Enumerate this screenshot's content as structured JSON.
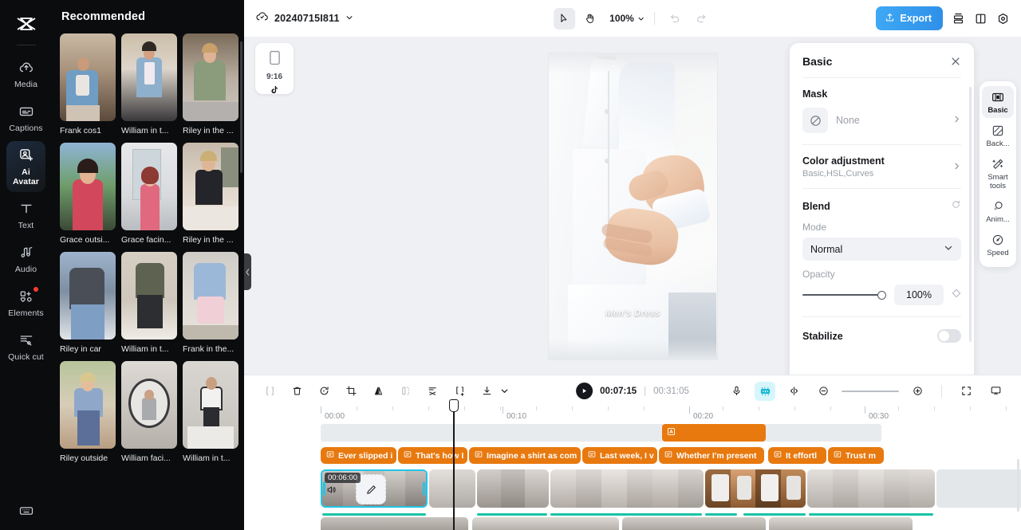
{
  "app": {
    "name": "CapCut"
  },
  "rail": {
    "items": [
      {
        "label": "Media",
        "icon": "cloud-upload-icon",
        "active": false,
        "badge": false
      },
      {
        "label": "Captions",
        "icon": "captions-icon",
        "active": false,
        "badge": false
      },
      {
        "label": "Ai Avatar",
        "icon": "ai-avatar-icon",
        "active": true,
        "badge": false
      },
      {
        "label": "Text",
        "icon": "text-icon",
        "active": false,
        "badge": false
      },
      {
        "label": "Audio",
        "icon": "audio-icon",
        "active": false,
        "badge": false
      },
      {
        "label": "Elements",
        "icon": "elements-icon",
        "active": false,
        "badge": true
      },
      {
        "label": "Quick cut",
        "icon": "quick-cut-icon",
        "active": false,
        "badge": false
      }
    ],
    "bottom_icon": "keyboard-shortcuts-icon"
  },
  "media": {
    "title": "Recommended",
    "items": [
      {
        "name": "Frank cos1"
      },
      {
        "name": "William in t..."
      },
      {
        "name": "Riley in the ..."
      },
      {
        "name": "Grace outsi..."
      },
      {
        "name": "Grace facin..."
      },
      {
        "name": "Riley in the ..."
      },
      {
        "name": "Riley in car"
      },
      {
        "name": "William in t..."
      },
      {
        "name": "Frank in the..."
      },
      {
        "name": "Riley outside"
      },
      {
        "name": "William faci..."
      },
      {
        "name": "William in t..."
      }
    ]
  },
  "topbar": {
    "project_name": "20240715I811",
    "project_icon": "cloud-sync-icon",
    "chevron_icon": "chevron-down-icon",
    "select_tool_icon": "cursor-arrow-icon",
    "hand_tool_icon": "hand-icon",
    "zoom_level": "100%",
    "undo_icon": "undo-icon",
    "redo_icon": "redo-icon",
    "export_label": "Export",
    "export_icon": "upload-icon",
    "export_color": "#3fa0ef",
    "right_icons": [
      {
        "name": "layout-stack-icon"
      },
      {
        "name": "split-view-icon"
      },
      {
        "name": "settings-gear-icon"
      }
    ]
  },
  "stage": {
    "ratio_card": {
      "ratio": "9:16",
      "platform_icon": "tiktok-icon",
      "frame_icon": "portrait-frame-icon"
    },
    "preview": {
      "watermark": "Men's Dress"
    }
  },
  "props": {
    "title": "Basic",
    "close_icon": "close-icon",
    "mask": {
      "label": "Mask",
      "value": "None",
      "icon": "mask-none-icon",
      "chevron": "chevron-right-icon"
    },
    "color_adjustment": {
      "label": "Color adjustment",
      "sub": "Basic,HSL,Curves",
      "chevron": "chevron-right-icon"
    },
    "blend": {
      "label": "Blend",
      "reset_icon": "reset-icon",
      "mode_label": "Mode",
      "mode_value": "Normal",
      "mode_chevron": "chevron-down-icon",
      "opacity_label": "Opacity",
      "opacity_value": "100%",
      "keyframe_icon": "keyframe-diamond-icon"
    },
    "stabilize": {
      "label": "Stabilize",
      "enabled": false
    }
  },
  "minirail": {
    "items": [
      {
        "label": "Basic",
        "icon": "basic-filmstrip-icon",
        "active": true
      },
      {
        "label": "Back...",
        "icon": "background-icon",
        "active": false
      },
      {
        "label": "Smart tools",
        "icon": "magic-wand-icon",
        "active": false
      },
      {
        "label": "Anim...",
        "icon": "animation-icon",
        "active": false
      },
      {
        "label": "Speed",
        "icon": "speed-gauge-icon",
        "active": false
      }
    ]
  },
  "timeline": {
    "toolbar_left": [
      {
        "name": "split-icon",
        "disabled": true
      },
      {
        "name": "delete-trash-icon",
        "disabled": false
      },
      {
        "name": "rotate-icon",
        "disabled": false
      },
      {
        "name": "crop-icon",
        "disabled": false
      },
      {
        "name": "mirror-flip-icon",
        "disabled": false
      },
      {
        "name": "freeze-frame-icon",
        "disabled": true
      },
      {
        "name": "auto-cut-icon",
        "disabled": false
      },
      {
        "name": "split-add-icon",
        "disabled": false
      },
      {
        "name": "download-icon",
        "disabled": false
      },
      {
        "name": "chevron-down-icon",
        "disabled": false
      }
    ],
    "play_icon": "play-icon",
    "current_time": "00:07:15",
    "separator": "|",
    "total_time": "00:31:05",
    "toolbar_right": [
      {
        "name": "microphone-icon"
      },
      {
        "name": "audio-stretch-icon"
      },
      {
        "name": "split-marker-icon"
      },
      {
        "name": "zoom-out-icon"
      },
      {
        "name": "zoom-in-icon"
      },
      {
        "name": "fit-screen-icon"
      },
      {
        "name": "monitor-preview-icon"
      }
    ],
    "ruler_labels": [
      "00:00",
      "00:10",
      "00:20",
      "00:30"
    ],
    "animation_clip": {
      "icon": "text-animation-icon"
    },
    "text_clips": [
      {
        "text": "Ever slipped i",
        "icon": "text-clip-icon"
      },
      {
        "text": "That's how I",
        "icon": "text-clip-icon"
      },
      {
        "text": "Imagine a shirt as com",
        "icon": "text-clip-icon"
      },
      {
        "text": "Last week, I v",
        "icon": "text-clip-icon"
      },
      {
        "text": "Whether I'm present",
        "icon": "text-clip-icon"
      },
      {
        "text": "It effortl",
        "icon": "text-clip-icon"
      },
      {
        "text": "Trust m",
        "icon": "text-clip-icon"
      }
    ],
    "video_track": {
      "speaker_icon": "volume-icon",
      "edit_icon": "edit-pencil-icon",
      "selected_clip_time": "00:06:00",
      "selection_color": "#23c4e8"
    },
    "second_track": {
      "speaker_icon": "volume-icon"
    }
  }
}
